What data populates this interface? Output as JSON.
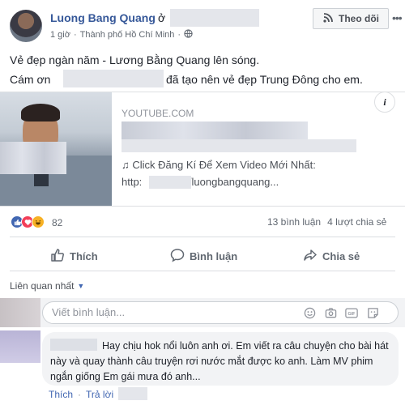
{
  "post": {
    "author": "Luong Bang Quang",
    "author_suffix": "ở",
    "time": "1 giờ",
    "meta_sep": "·",
    "location": "Thành phố Hồ Chí Minh",
    "follow_label": "Theo dõi",
    "text_line1": "Vẻ đẹp ngàn năm - Lương Bằng Quang lên sóng.",
    "text_line2_start": "Cám ơn",
    "text_line2_end": "đã tạo nên vẻ đẹp Trung Đông cho em."
  },
  "link_card": {
    "source": "YOUTUBE.COM",
    "description": "♫ Click Đăng Kí Để Xem Video Mới Nhất:",
    "url_start": "http:",
    "url_end": "t/luongbangquang..."
  },
  "stats": {
    "reaction_count": "82",
    "comments": "13 bình luận",
    "shares": "4 lượt chia sẻ"
  },
  "actions": {
    "like": "Thích",
    "comment": "Bình luận",
    "share": "Chia sẻ"
  },
  "comments_section": {
    "filter_label": "Liên quan nhất",
    "input_placeholder": "Viết bình luận...",
    "reply": {
      "text": "Hay chịu hok nổi luôn anh ơi. Em viết ra câu chuyện cho bài hát này và quay thành câu truyện rơi nước mắt được ko anh. Làm MV phim ngắn giống Em gái mưa đó anh...",
      "like_label": "Thích",
      "sep": "·",
      "reply_label": "Trả lời"
    }
  },
  "colors": {
    "link_blue": "#365899",
    "accent_blue": "#4267b2",
    "muted": "#606770"
  }
}
